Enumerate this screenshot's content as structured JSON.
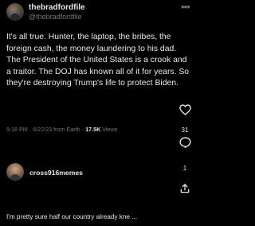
{
  "post": {
    "author_name": "thebradfordfile",
    "author_handle": "@thebradfordfile",
    "text": "It's all true. Hunter, the laptop, the bribes, the foreign cash, the money laundering to his dad. The President of the United States is a crook and a traitor. The DOJ has known all of it for years. So they're destroying Trump's life to protect Biden.",
    "timestamp": "9:18 PM · 6/22/23 from Earth · ",
    "views_count": "17.5K",
    "views_label": " Views"
  },
  "actions": {
    "reply_count": "31",
    "share_count": "1"
  },
  "reply": {
    "author_name": "cross916memes",
    "text": "I'm pretty sure half our country already kne ..."
  },
  "icons": {
    "more": "more-dots-icon",
    "like": "heart-icon",
    "reply": "reply-bubble-icon",
    "share": "share-icon"
  },
  "colors": {
    "background": "#000000",
    "text_primary": "#e7e9ea",
    "text_secondary": "#71767b"
  }
}
